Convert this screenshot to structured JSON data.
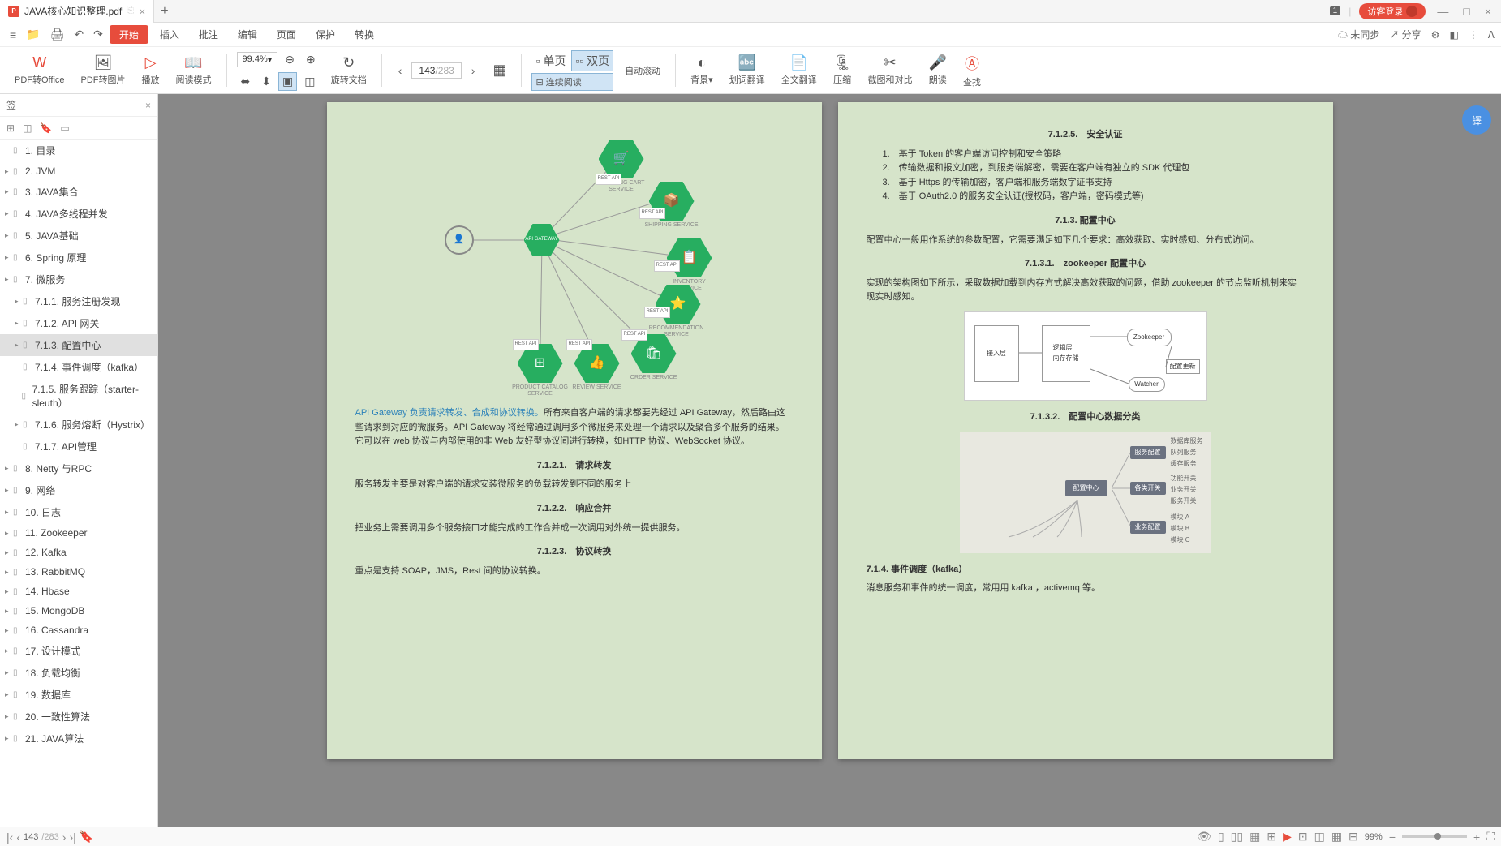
{
  "titlebar": {
    "tab_title": "JAVA核心知识整理.pdf",
    "pdf_badge": "P",
    "badge": "1",
    "guest_login": "访客登录"
  },
  "menubar": {
    "start": "开始",
    "items": [
      "插入",
      "批注",
      "编辑",
      "页面",
      "保护",
      "转换"
    ],
    "sync": "未同步",
    "share": "分享"
  },
  "toolbar": {
    "pdf_office": "PDF转Office",
    "pdf_image": "PDF转图片",
    "play": "播放",
    "read_mode": "阅读模式",
    "zoom": "99.4%",
    "rotate": "旋转文档",
    "page_current": "143",
    "page_total": "/283",
    "single": "单页",
    "double": "双页",
    "continuous": "连续阅读",
    "auto_scroll": "自动滚动",
    "background": "背景",
    "word_translate": "划词翻译",
    "full_translate": "全文翻译",
    "compress": "压缩",
    "screenshot": "截图和对比",
    "read_aloud": "朗读",
    "find": "查找"
  },
  "sidebar": {
    "title": "签",
    "items": [
      {
        "label": "1. 目录",
        "indent": 0,
        "arrow": false
      },
      {
        "label": "2. JVM",
        "indent": 0,
        "arrow": true
      },
      {
        "label": "3. JAVA集合",
        "indent": 0,
        "arrow": true
      },
      {
        "label": "4. JAVA多线程并发",
        "indent": 0,
        "arrow": true
      },
      {
        "label": "5. JAVA基础",
        "indent": 0,
        "arrow": true
      },
      {
        "label": "6. Spring 原理",
        "indent": 0,
        "arrow": true
      },
      {
        "label": "7.  微服务",
        "indent": 0,
        "arrow": true
      },
      {
        "label": "7.1.1. 服务注册发现",
        "indent": 1,
        "arrow": true
      },
      {
        "label": "7.1.2. API 网关",
        "indent": 1,
        "arrow": true
      },
      {
        "label": "7.1.3. 配置中心",
        "indent": 1,
        "arrow": true,
        "active": true
      },
      {
        "label": "7.1.4. 事件调度（kafka）",
        "indent": 1,
        "arrow": false
      },
      {
        "label": "7.1.5. 服务跟踪（starter-sleuth）",
        "indent": 1,
        "arrow": false
      },
      {
        "label": "7.1.6. 服务熔断（Hystrix）",
        "indent": 1,
        "arrow": true
      },
      {
        "label": "7.1.7. API管理",
        "indent": 1,
        "arrow": false
      },
      {
        "label": "8. Netty 与RPC",
        "indent": 0,
        "arrow": true
      },
      {
        "label": "9. 网络",
        "indent": 0,
        "arrow": true
      },
      {
        "label": "10. 日志",
        "indent": 0,
        "arrow": true
      },
      {
        "label": "11. Zookeeper",
        "indent": 0,
        "arrow": true
      },
      {
        "label": "12. Kafka",
        "indent": 0,
        "arrow": true
      },
      {
        "label": "13. RabbitMQ",
        "indent": 0,
        "arrow": true
      },
      {
        "label": "14. Hbase",
        "indent": 0,
        "arrow": true
      },
      {
        "label": "15. MongoDB",
        "indent": 0,
        "arrow": true
      },
      {
        "label": "16. Cassandra",
        "indent": 0,
        "arrow": true
      },
      {
        "label": "17. 设计模式",
        "indent": 0,
        "arrow": true
      },
      {
        "label": "18. 负载均衡",
        "indent": 0,
        "arrow": true
      },
      {
        "label": "19. 数据库",
        "indent": 0,
        "arrow": true
      },
      {
        "label": "20. 一致性算法",
        "indent": 0,
        "arrow": true
      },
      {
        "label": "21. JAVA算法",
        "indent": 0,
        "arrow": true
      }
    ]
  },
  "page_left": {
    "diagram": {
      "user": "👤",
      "gateway": "API GATEWAY",
      "services": [
        {
          "name": "SHOPPING CART SERVICE",
          "icon": "🛒"
        },
        {
          "name": "SHIPPING SERVICE",
          "icon": "📦"
        },
        {
          "name": "INVENTORY SERVICE",
          "icon": "📋"
        },
        {
          "name": "RECOMMENDATION SERVICE",
          "icon": "⭐"
        },
        {
          "name": "ORDER SERVICE",
          "icon": "🛍"
        },
        {
          "name": "REVIEW SERVICE",
          "icon": "👍"
        },
        {
          "name": "PRODUCT CATALOG SERVICE",
          "icon": "⊞"
        }
      ],
      "rest": "REST API"
    },
    "highlight": "API Gateway 负责请求转发、合成和协议转换。",
    "para1": "所有来自客户端的请求都要先经过 API Gateway，然后路由这些请求到对应的微服务。API Gateway 将经常通过调用多个微服务来处理一个请求以及聚合多个服务的结果。它可以在 web 协议与内部使用的非 Web 友好型协议间进行转换，如HTTP 协议、WebSocket 协议。",
    "h1": "7.1.2.1.　请求转发",
    "p1": "服务转发主要是对客户端的请求安装微服务的负载转发到不同的服务上",
    "h2": "7.1.2.2.　响应合并",
    "p2": "把业务上需要调用多个服务接口才能完成的工作合并成一次调用对外统一提供服务。",
    "h3": "7.1.2.3.　协议转换",
    "p3": "重点是支持 SOAP，JMS，Rest 间的协议转换。"
  },
  "page_right": {
    "h0": "7.1.2.5.　安全认证",
    "list": [
      "1.　基于 Token 的客户端访问控制和安全策略",
      "2.　传输数据和报文加密，到服务端解密，需要在客户端有独立的 SDK 代理包",
      "3.　基于 Https 的传输加密，客户端和服务端数字证书支持",
      "4.　基于 OAuth2.0 的服务安全认证(授权码，客户端，密码模式等)"
    ],
    "h1": "7.1.3. 配置中心",
    "p1": "配置中心一般用作系统的参数配置，它需要满足如下几个要求：高效获取、实时感知、分布式访问。",
    "h2": "7.1.3.1.　zookeeper 配置中心",
    "p2": "实现的架构图如下所示，采取数据加载到内存方式解决高效获取的问题，借助 zookeeper 的节点监听机制来实现实时感知。",
    "arch": {
      "box1": "接入层",
      "box2": "逻辑层\n内存存储",
      "box3": "Zookeeper",
      "box4": "配置更新",
      "box5": "Watcher"
    },
    "h3": "7.1.3.2.　配置中心数据分类",
    "mind": {
      "center": "配置中心",
      "n1": "服务配置",
      "n2": "各类开关",
      "n3": "业务配置",
      "leaves": [
        "数据库服务",
        "队列服务",
        "缓存服务",
        "功能开关",
        "业务开关",
        "服务开关",
        "模块 A",
        "模块 B",
        "模块 C"
      ]
    },
    "h4": "7.1.4. 事件调度（kafka）",
    "p4": "消息服务和事件的统一调度，常用用 kafka ，activemq 等。"
  },
  "statusbar": {
    "page": "143",
    "total": "/283",
    "zoom": "99%"
  }
}
